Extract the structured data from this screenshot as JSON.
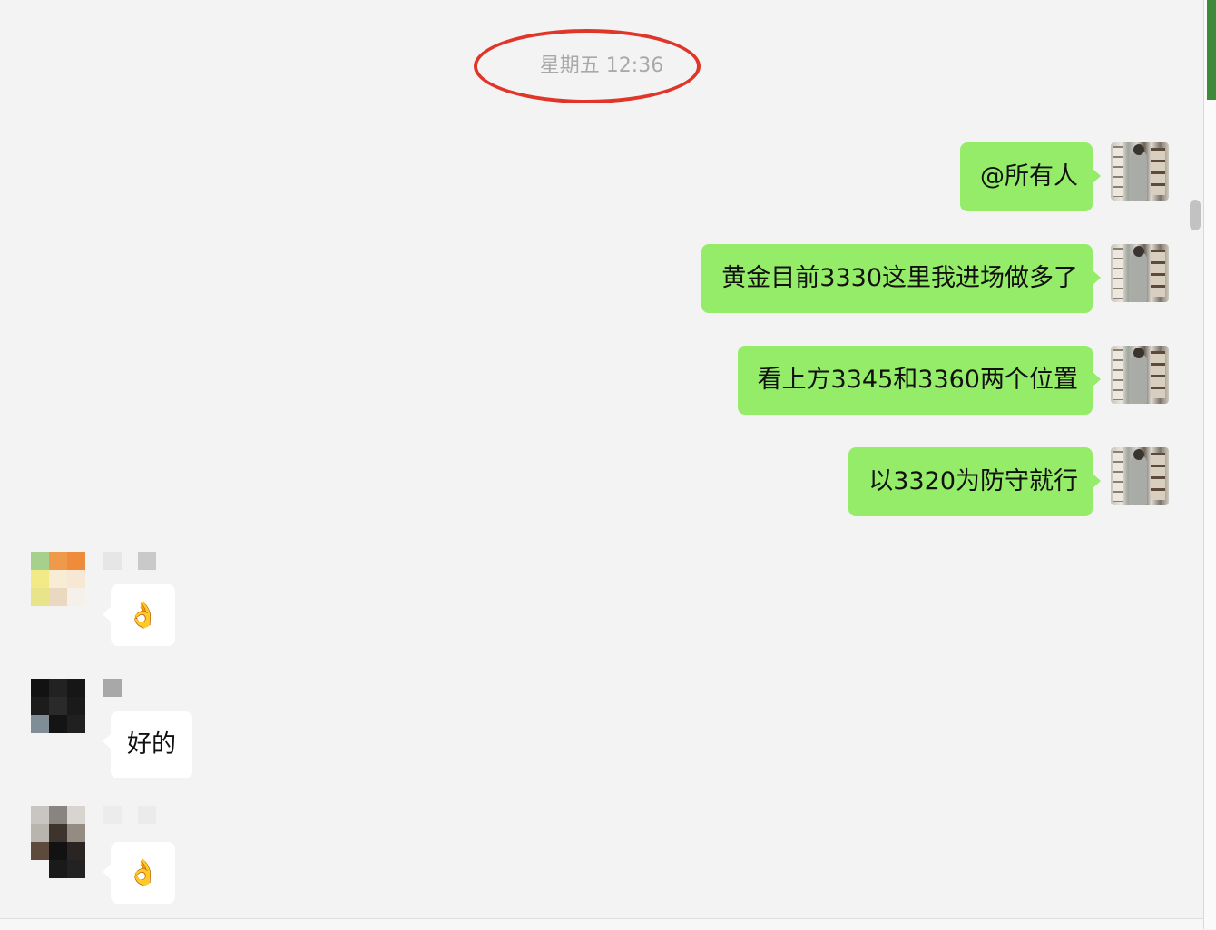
{
  "timestamp": "星期五 12:36",
  "messages_sent": [
    {
      "text": "@所有人"
    },
    {
      "text": "黄金目前3330这里我进场做多了"
    },
    {
      "text": "看上方3345和3360两个位置"
    },
    {
      "text": "以3320为防守就行"
    }
  ],
  "messages_received": [
    {
      "text": "👌"
    },
    {
      "text": "好的"
    },
    {
      "text": "👌"
    }
  ],
  "colors": {
    "sent_bubble": "#95ec69",
    "received_bubble": "#ffffff",
    "background": "#f3f3f3",
    "highlight_circle": "#e0362a"
  }
}
